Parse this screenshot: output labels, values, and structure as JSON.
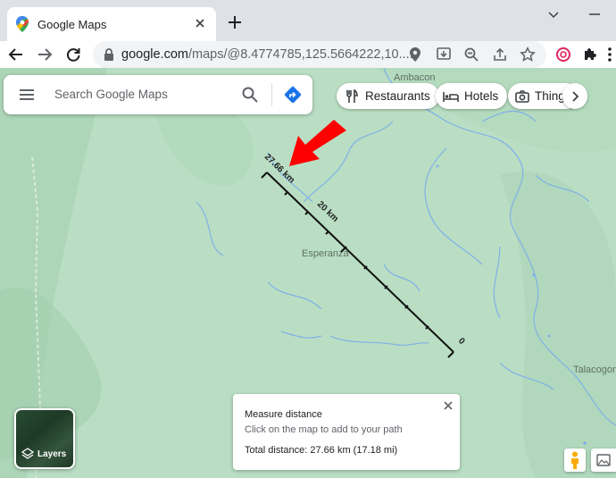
{
  "browser": {
    "tab_title": "Google Maps",
    "url_host": "google.com",
    "url_path": "/maps/@8.4774785,125.5664222,10...."
  },
  "search": {
    "placeholder": "Search Google Maps"
  },
  "chips": [
    {
      "label": "Restaurants",
      "icon": "fork-knife-icon"
    },
    {
      "label": "Hotels",
      "icon": "bed-icon"
    },
    {
      "label": "Things",
      "icon": "camera-icon"
    }
  ],
  "places": {
    "ambacon": "Ambacon",
    "esperanza": "Esperanza",
    "talacogon": "Talacogon"
  },
  "layers": {
    "label": "Layers"
  },
  "measure": {
    "title": "Measure distance",
    "hint": "Click on the map to add to your path",
    "total": "Total distance: 27.66 km (17.18 mi)"
  },
  "ruler": {
    "label_start": "27.66 km",
    "label_mid": "20 km",
    "label_end": "0"
  },
  "colors": {
    "map_bg": "#b9dec3",
    "water": "#7fb0e8",
    "arrow": "#ff0000",
    "accent_blue": "#1a73e8"
  }
}
